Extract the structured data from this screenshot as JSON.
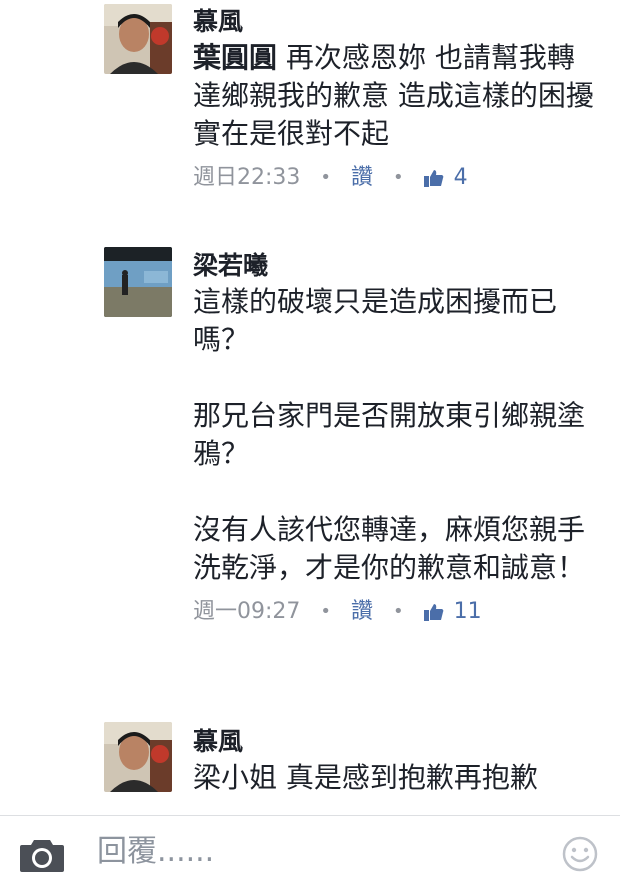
{
  "comments": [
    {
      "author": "慕風",
      "mention": "葉圓圓",
      "text": " 再次感恩妳 也請幫我轉達鄉親我的歉意 造成這樣的困擾實在是很對不起",
      "time": "週日22:33",
      "like_label": "讚",
      "like_count": "4"
    },
    {
      "author": "梁若曦",
      "text": "這樣的破壞只是造成困擾而已嗎？\n\n那兄台家門是否開放東引鄉親塗鴉？\n\n沒有人該代您轉達，麻煩您親手洗乾淨，才是你的歉意和誠意！",
      "time": "週一09:27",
      "like_label": "讚",
      "like_count": "11"
    },
    {
      "author": "慕風",
      "text": "梁小姐 真是感到抱歉再抱歉"
    }
  ],
  "composer": {
    "placeholder": "回覆......",
    "camera_icon": "camera-icon",
    "emoji_icon": "smiley-icon"
  },
  "colors": {
    "link_blue": "#4b6ea9",
    "meta_gray": "#90949c",
    "text": "#1d2129"
  }
}
